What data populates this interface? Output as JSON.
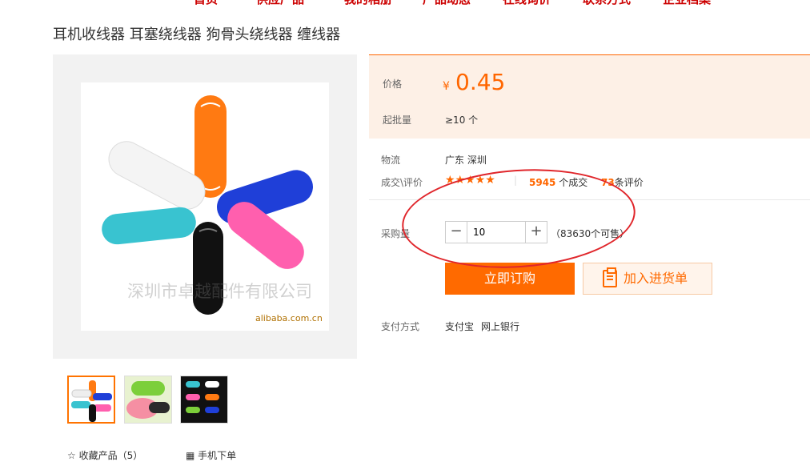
{
  "nav": [
    "首页",
    "供应产品",
    "我的相册",
    "产品动态",
    "在线询价",
    "联系方式",
    "企业档案"
  ],
  "product_title": "耳机收线器 耳塞绕线器 狗骨头绕线器 缠线器",
  "gallery": {
    "watermark": "深圳市卓越配件有限公司",
    "source": "alibaba.com.cn"
  },
  "price": {
    "label": "价格",
    "currency": "¥",
    "value": "0.45"
  },
  "moq": {
    "label": "起批量",
    "value": "≥10 个"
  },
  "logistics": {
    "label": "物流",
    "value": "广东 深圳"
  },
  "deals": {
    "label": "成交\\评价",
    "rating": 4.5,
    "stars": "★★★★★",
    "count": "5945",
    "count_suffix": "个成交",
    "reviews": "73",
    "reviews_suffix": "条评价",
    "divider": "|"
  },
  "quantity": {
    "label": "采购量",
    "minus": "−",
    "plus": "+",
    "value": "10",
    "stock": "（83630个可售）"
  },
  "buttons": {
    "buy": "立即订购",
    "cart": "加入进货单"
  },
  "payment": {
    "label": "支付方式",
    "methods": [
      "支付宝",
      "网上银行"
    ]
  },
  "bottom": {
    "favorite": "收藏产品（5）",
    "mobile": "手机下单"
  },
  "colors": {
    "accent": "#ff6a00",
    "nav": "#cc0000",
    "annotation": "#e0262b"
  }
}
